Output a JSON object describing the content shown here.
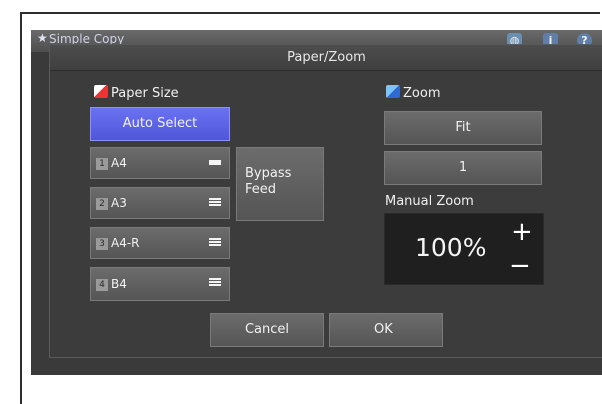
{
  "topbar": {
    "title": "Simple Copy",
    "icons": [
      "globe-icon",
      "info-icon",
      "help-icon"
    ],
    "info_glyph": "i",
    "help_glyph": "?"
  },
  "dialog": {
    "title": "Paper/Zoom",
    "paper_size": {
      "label": "Paper Size",
      "auto_select": "Auto Select",
      "trays": [
        {
          "num": "1",
          "name": "A4",
          "indicator": "low"
        },
        {
          "num": "2",
          "name": "A3",
          "indicator": "full"
        },
        {
          "num": "3",
          "name": "A4-R",
          "indicator": "full"
        },
        {
          "num": "4",
          "name": "B4",
          "indicator": "full"
        }
      ],
      "bypass": "Bypass Feed"
    },
    "zoom": {
      "label": "Zoom",
      "fit": "Fit",
      "one": "1",
      "manual_label": "Manual Zoom",
      "value": "100%",
      "plus": "+",
      "minus": "−"
    },
    "cancel": "Cancel",
    "ok": "OK"
  },
  "colors": {
    "accent_blue": "#5a60e6",
    "background": "#3a3a3a"
  }
}
